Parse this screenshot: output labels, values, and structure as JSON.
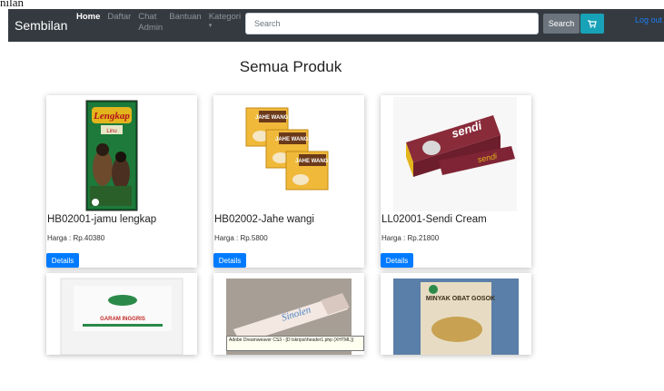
{
  "page_label": "nilan",
  "navbar": {
    "brand": "Sembilan",
    "links": [
      {
        "label": "Home",
        "active": true
      },
      {
        "label": "Daftar",
        "active": false
      },
      {
        "label": "Chat Admin",
        "active": false
      },
      {
        "label": "Bantuan",
        "active": false
      },
      {
        "label": "Kategori",
        "active": false
      }
    ],
    "search_placeholder": "Search",
    "search_button": "Search",
    "logout": "Log out",
    "colors": {
      "bg": "#343a40",
      "search_btn": "#6c757d",
      "cart_btn": "#17a2b8",
      "link": "#1d7cf2"
    }
  },
  "main": {
    "title": "Semua Produk",
    "products": [
      {
        "name": "HB02001-jamu lengkap",
        "price": "Harga : Rp.40380",
        "button": "Details",
        "image_label": "Lengkap",
        "image_sub": "Linu"
      },
      {
        "name": "HB02002-Jahe wangi",
        "price": "Harga : Rp.5800",
        "button": "Details",
        "image_label": "JAHE WANGI"
      },
      {
        "name": "LL02001-Sendi Cream",
        "price": "Harga : Rp.21800",
        "button": "Details",
        "image_label": "sendi"
      },
      {
        "name": "",
        "price": "",
        "button": "",
        "image_label": "GARAM INGGRIS"
      },
      {
        "name": "",
        "price": "",
        "button": "",
        "image_label": "Sinolen"
      },
      {
        "name": "",
        "price": "",
        "button": "",
        "image_label": "MINYAK OBAT GOSOK"
      }
    ]
  },
  "tooltip": "Adobe Dreamweaver CS3 - [D:\\skripsi\\header1.php (XHTML)]"
}
